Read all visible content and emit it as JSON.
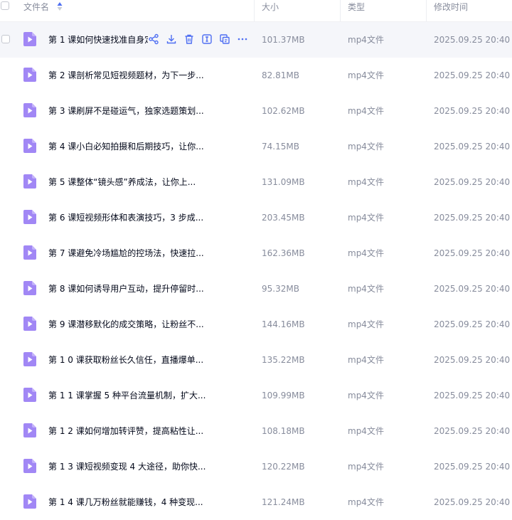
{
  "header": {
    "name": "文件名",
    "size": "大小",
    "type": "类型",
    "modified": "修改时间"
  },
  "colors": {
    "accent": "#4e6ef2",
    "file_icon": "#a187f5",
    "header_text": "#878c9c",
    "row_hover": "#f5f6fa"
  },
  "icons": {
    "sort": "sort-ascending-icon",
    "file": "video-file-icon",
    "row_actions": [
      "share-icon",
      "download-icon",
      "delete-icon",
      "rename-icon",
      "copy-icon",
      "more-icon"
    ]
  },
  "files": [
    {
      "name": "第 1 课如何快速找准自身定位",
      "size": "101.37MB",
      "type": "mp4文件",
      "modified": "2025.09.25 20:40"
    },
    {
      "name": "第 2 课剖析常见短视频题材，为下一步...",
      "size": "82.81MB",
      "type": "mp4文件",
      "modified": "2025.09.25 20:40"
    },
    {
      "name": "第 3 课刷屏不是碰运气，独家选题策划...",
      "size": "102.62MB",
      "type": "mp4文件",
      "modified": "2025.09.25 20:40"
    },
    {
      "name": "第 4 课小白必知拍摄和后期技巧，让你...",
      "size": "74.15MB",
      "type": "mp4文件",
      "modified": "2025.09.25 20:40"
    },
    {
      "name": "第 5 课整体“镜头感”养成法，让你上...",
      "size": "131.09MB",
      "type": "mp4文件",
      "modified": "2025.09.25 20:40"
    },
    {
      "name": "第 6 课短视频形体和表演技巧，3 步成...",
      "size": "203.45MB",
      "type": "mp4文件",
      "modified": "2025.09.25 20:40"
    },
    {
      "name": "第 7 课避免冷场尴尬的控场法，快速拉...",
      "size": "162.36MB",
      "type": "mp4文件",
      "modified": "2025.09.25 20:40"
    },
    {
      "name": "第 8 课如何诱导用户互动，提升停留时...",
      "size": "95.32MB",
      "type": "mp4文件",
      "modified": "2025.09.25 20:40"
    },
    {
      "name": "第 9 课潜移默化的成交策略，让粉丝不...",
      "size": "144.16MB",
      "type": "mp4文件",
      "modified": "2025.09.25 20:40"
    },
    {
      "name": "第 1 0 课获取粉丝长久信任，直播爆单...",
      "size": "135.22MB",
      "type": "mp4文件",
      "modified": "2025.09.25 20:40"
    },
    {
      "name": "第 1 1 课掌握 5 种平台流量机制，扩大...",
      "size": "109.99MB",
      "type": "mp4文件",
      "modified": "2025.09.25 20:40"
    },
    {
      "name": "第 1 2 课如何增加转评赞，提高粘性让...",
      "size": "108.18MB",
      "type": "mp4文件",
      "modified": "2025.09.25 20:40"
    },
    {
      "name": "第 1 3 课短视频变现 4 大途径，助你快...",
      "size": "120.22MB",
      "type": "mp4文件",
      "modified": "2025.09.25 20:40"
    },
    {
      "name": "第 1 4 课几万粉丝就能赚钱，4 种变现...",
      "size": "121.24MB",
      "type": "mp4文件",
      "modified": "2025.09.25 20:40"
    }
  ]
}
